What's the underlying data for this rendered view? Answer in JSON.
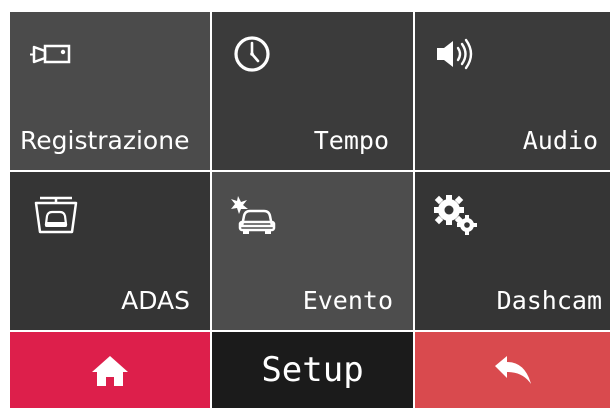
{
  "menu": {
    "tiles": [
      {
        "label": "Registrazione",
        "icon": "video-camera-icon"
      },
      {
        "label": "Tempo",
        "icon": "clock-icon"
      },
      {
        "label": "Audio",
        "icon": "speaker-volume-icon"
      },
      {
        "label": "ADAS",
        "icon": "lane-assist-car-icon"
      },
      {
        "label": "Evento",
        "icon": "car-collision-icon"
      },
      {
        "label": "Dashcam",
        "icon": "gears-icon"
      }
    ]
  },
  "bottom_bar": {
    "title": "Setup",
    "home_icon": "home-icon",
    "back_icon": "back-arrow-icon"
  },
  "colors": {
    "home_button": "#dd1f4b",
    "back_button": "#d94a4e",
    "title_bar": "#1b1b1b",
    "tile_dark": "#353535",
    "tile_light": "#4b4b4b"
  }
}
